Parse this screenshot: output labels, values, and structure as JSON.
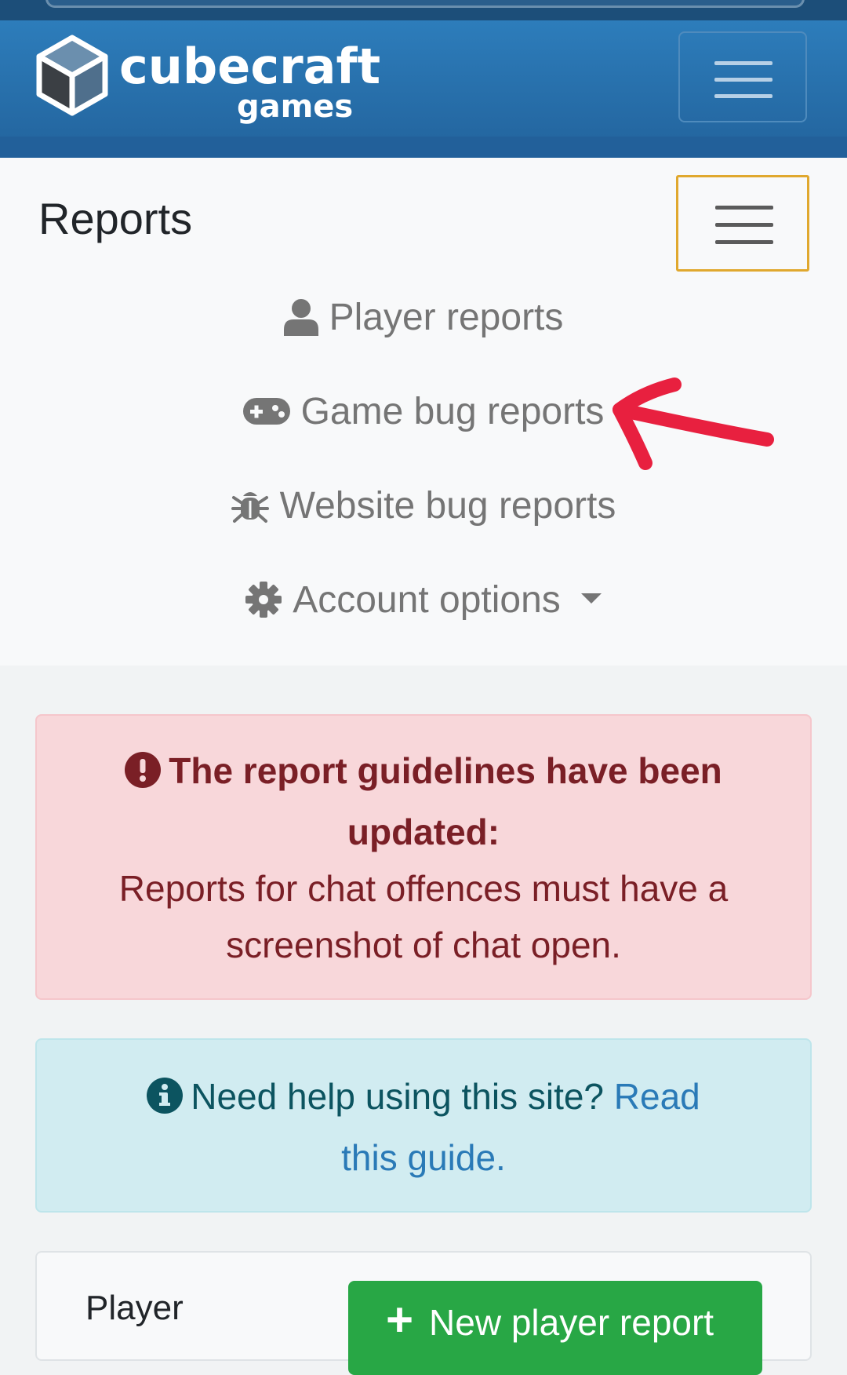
{
  "header": {
    "brand_top": "cubecraft",
    "brand_bottom": "games"
  },
  "subnav": {
    "title": "Reports",
    "items": [
      {
        "label": "Player reports",
        "icon": "user-icon"
      },
      {
        "label": "Game bug reports",
        "icon": "gamepad-icon"
      },
      {
        "label": "Website bug reports",
        "icon": "bug-icon"
      },
      {
        "label": "Account options",
        "icon": "gear-icon"
      }
    ]
  },
  "alerts": {
    "danger": {
      "headline": "The report guidelines have been updated:",
      "body": "Reports for chat offences must have a screenshot of chat open."
    },
    "info": {
      "text": "Need help using this site?",
      "link": "Read this guide."
    }
  },
  "card": {
    "label": "Player",
    "button": "New player report"
  },
  "colors": {
    "header": "#2a72b0",
    "danger_text": "#7a1f26",
    "info_text": "#0c5460",
    "success": "#28a745",
    "annotation_arrow": "#e8203f"
  }
}
